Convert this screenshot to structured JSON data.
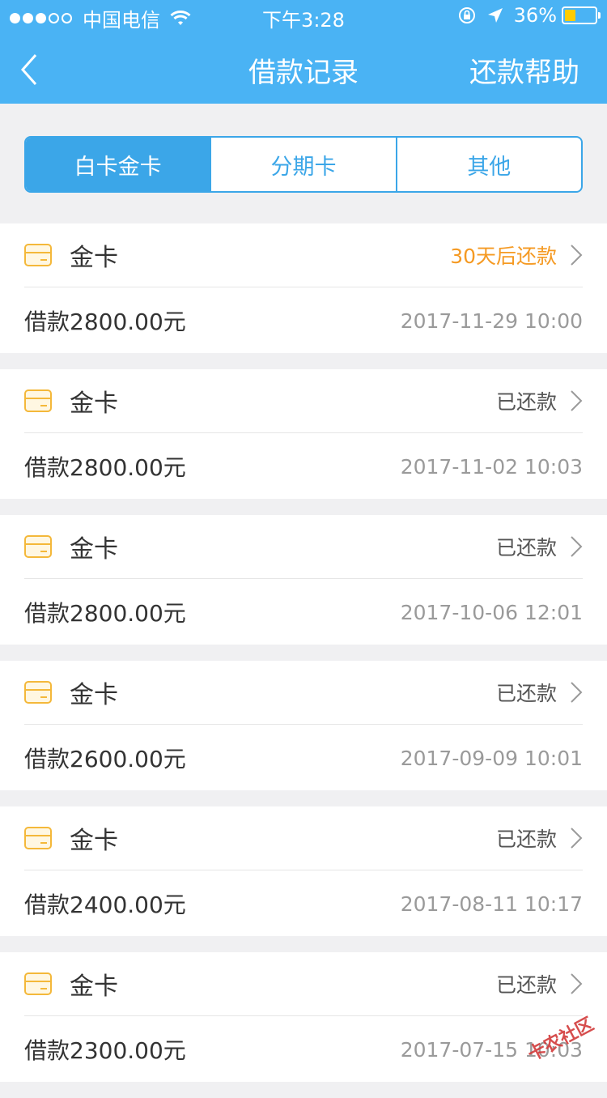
{
  "status_bar": {
    "carrier": "中国电信",
    "time": "下午3:28",
    "battery": "36%",
    "battery_level": 0.36
  },
  "nav": {
    "title": "借款记录",
    "help_label": "还款帮助",
    "back_icon": "chevron-left-icon"
  },
  "tabs": [
    {
      "label": "白卡金卡",
      "active": true
    },
    {
      "label": "分期卡",
      "active": false
    },
    {
      "label": "其他",
      "active": false
    }
  ],
  "records": [
    {
      "card": "金卡",
      "status": "30天后还款",
      "status_due": true,
      "amount": "借款2800.00元",
      "time": "2017-11-29 10:00"
    },
    {
      "card": "金卡",
      "status": "已还款",
      "status_due": false,
      "amount": "借款2800.00元",
      "time": "2017-11-02 10:03"
    },
    {
      "card": "金卡",
      "status": "已还款",
      "status_due": false,
      "amount": "借款2800.00元",
      "time": "2017-10-06 12:01"
    },
    {
      "card": "金卡",
      "status": "已还款",
      "status_due": false,
      "amount": "借款2600.00元",
      "time": "2017-09-09 10:01"
    },
    {
      "card": "金卡",
      "status": "已还款",
      "status_due": false,
      "amount": "借款2400.00元",
      "time": "2017-08-11 10:17"
    },
    {
      "card": "金卡",
      "status": "已还款",
      "status_due": false,
      "amount": "借款2300.00元",
      "time": "2017-07-15 10:03"
    }
  ],
  "watermark": "卡农社区",
  "colors": {
    "brand": "#4ab3f4",
    "accent": "#3ba6e8",
    "due": "#f59a23",
    "card_icon": "#f4b83a"
  }
}
